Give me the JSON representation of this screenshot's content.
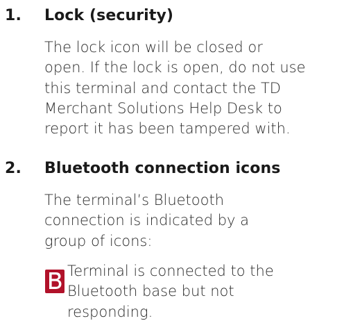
{
  "items": [
    {
      "number": "1.",
      "title": "Lock (security)",
      "lines": [
        "The lock icon will be closed or",
        "open. If the lock is open, do not use",
        "this terminal and contact the TD",
        "Merchant Solutions Help Desk to",
        "report it has been tampered with."
      ]
    },
    {
      "number": "2.",
      "title": "Bluetooth connection icons",
      "lines": [
        "The terminal’s Bluetooth",
        "connection is indicated by a",
        "group of icons:"
      ]
    }
  ],
  "icon_entry": {
    "icon": "bluetooth-b-icon",
    "icon_color": "#b1122a",
    "lines": [
      "Terminal is connected to the",
      "Bluetooth base but not",
      "responding."
    ]
  }
}
